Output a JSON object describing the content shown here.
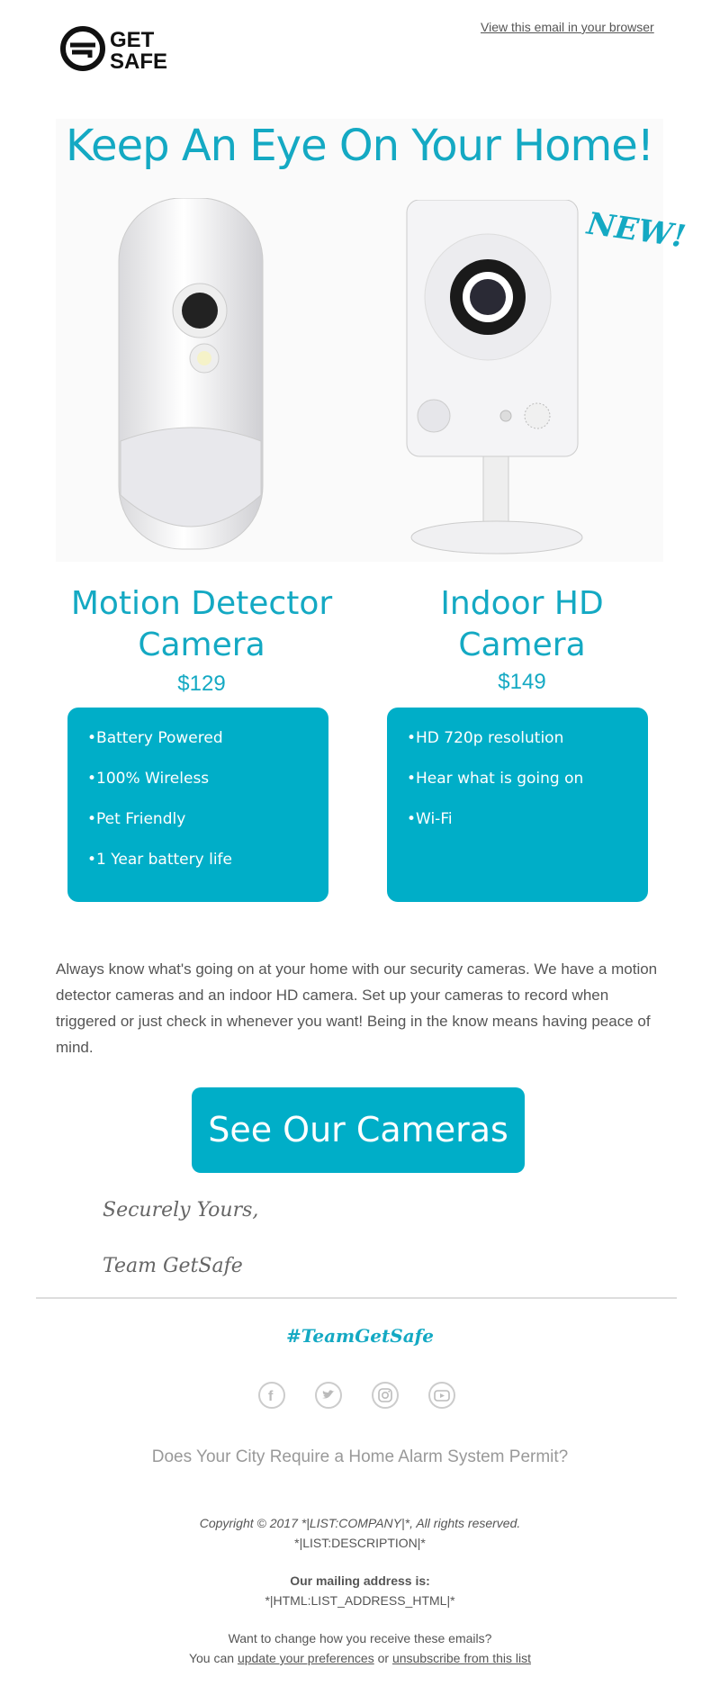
{
  "header": {
    "browser_link": "View this email in your browser",
    "logo_line1": "GET",
    "logo_line2": "SAFE"
  },
  "hero": {
    "headline": "Keep An Eye On Your Home!",
    "new_badge": "NEW!"
  },
  "products": [
    {
      "title_line1": "Motion Detector",
      "title_line2": "Camera",
      "price": "$129",
      "features": [
        "•Battery Powered",
        "•100% Wireless",
        "•Pet Friendly",
        "•1 Year battery life"
      ]
    },
    {
      "title_line1": "Indoor HD",
      "title_line2": "Camera",
      "price": "$149",
      "features": [
        "•HD 720p resolution",
        "•Hear what is going on",
        "•Wi-Fi"
      ]
    }
  ],
  "body": {
    "text": "Always know what's going on at your home with our security cameras. We have a motion detector cameras and an indoor HD camera. Set up your cameras to record when triggered or just check in whenever you want! Being in the know means having peace of mind."
  },
  "cta": {
    "label": "See Our Cameras"
  },
  "signature": {
    "line1": "Securely Yours,",
    "line2": "Team GetSafe"
  },
  "footer": {
    "hashtag": "#TeamGetSafe",
    "social_icons": [
      "facebook-icon",
      "twitter-icon",
      "instagram-icon",
      "youtube-icon"
    ],
    "permit_link": "Does Your City Require a Home Alarm System Permit?",
    "copyright": "Copyright © 2017 *|LIST:COMPANY|*, All rights reserved.",
    "description": "*|LIST:DESCRIPTION|*",
    "mailing_label": "Our mailing address is:",
    "mailing_address": "*|HTML:LIST_ADDRESS_HTML|*",
    "change_text": "Want to change how you receive these emails?",
    "you_can": "You can",
    "update_link": "update your preferences",
    "or": "or",
    "unsubscribe_link": "unsubscribe from this list"
  },
  "colors": {
    "accent": "#00aec8",
    "text": "#555555",
    "muted": "#999999"
  }
}
